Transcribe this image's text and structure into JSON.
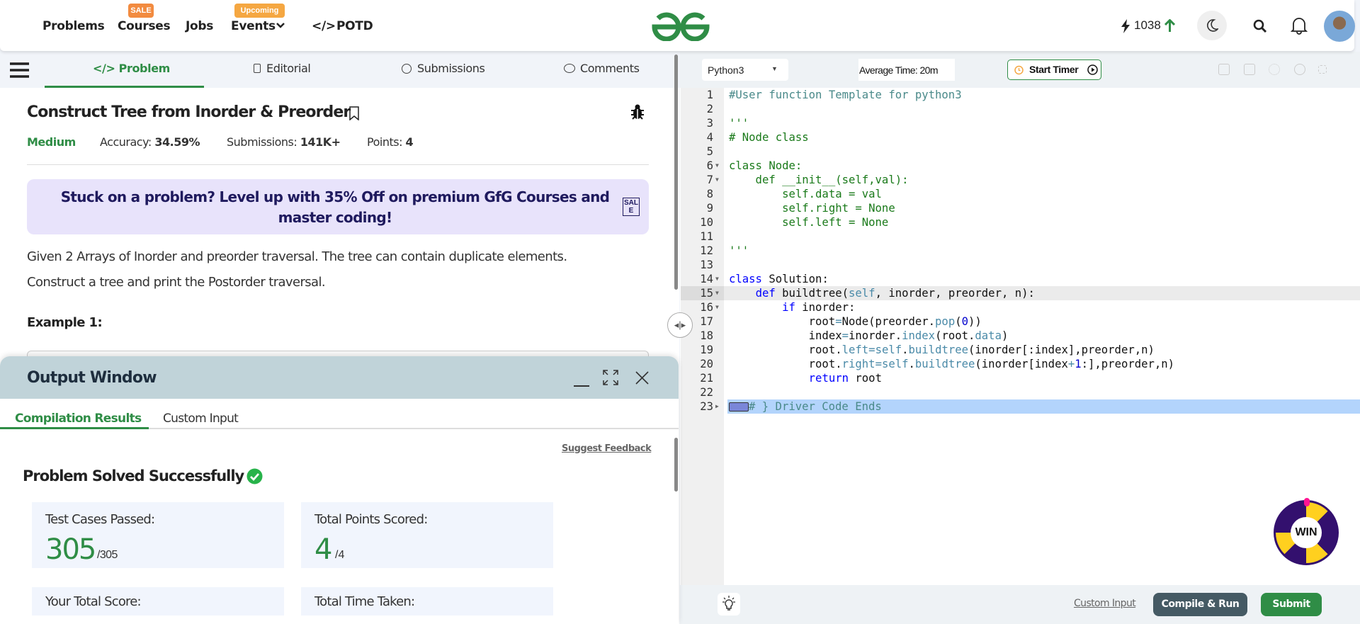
{
  "header": {
    "nav": [
      {
        "label": "Problems"
      },
      {
        "label": "Courses",
        "badge": "SALE"
      },
      {
        "label": "Jobs"
      },
      {
        "label": "Events",
        "badge": "Upcoming"
      },
      {
        "label": "POTD"
      }
    ],
    "potd_icon": "</>",
    "streak": "1038",
    "icons": [
      "bolt-icon",
      "arrow-up-icon",
      "moon-icon",
      "search-icon",
      "bell-icon",
      "avatar"
    ],
    "colors": {
      "brand": "#2f8d46",
      "sale_badge": "#f28b40",
      "upcoming_badge": "#f5a742"
    }
  },
  "left": {
    "tabs": [
      {
        "label": "Problem",
        "icon": "</>",
        "active": true
      },
      {
        "label": "Editorial"
      },
      {
        "label": "Submissions"
      },
      {
        "label": "Comments"
      }
    ],
    "problem": {
      "title": "Construct Tree from Inorder & Preorder",
      "difficulty": "Medium",
      "accuracy_label": "Accuracy:",
      "accuracy": "34.59%",
      "submissions_label": "Submissions:",
      "submissions": "141K+",
      "points_label": "Points:",
      "points": "4",
      "banner": "Stuck on a problem? Level up with 35% Off on premium GfG Courses and master coding!",
      "banner_badge": "SALE",
      "description": [
        "Given 2 Arrays of Inorder and preorder traversal. The tree can contain duplicate elements.",
        "Construct a tree and print the Postorder traversal."
      ],
      "example_heading": "Example 1:"
    }
  },
  "output": {
    "title": "Output Window",
    "tabs": [
      {
        "label": "Compilation Results",
        "active": true
      },
      {
        "label": "Custom Input"
      }
    ],
    "suggest_feedback": "Suggest Feedback",
    "status": "Problem Solved Successfully",
    "cards": [
      {
        "label": "Test Cases Passed:",
        "value": "305",
        "total": "/305"
      },
      {
        "label": "Total Points Scored:",
        "value": "4",
        "total": "/4"
      },
      {
        "label": "Your Total Score:"
      },
      {
        "label": "Total Time Taken:"
      }
    ]
  },
  "editor": {
    "language": "Python3",
    "average_time": "Average Time: 20m",
    "start_timer": "Start Timer",
    "code": [
      [
        [
          "#User function Template for python3",
          "cm"
        ]
      ],
      [],
      [
        [
          "'''",
          "st"
        ]
      ],
      [
        [
          "# Node class",
          "st"
        ]
      ],
      [],
      [
        [
          "class Node:",
          "st"
        ]
      ],
      [
        [
          "    def __init__(self,val):",
          "st"
        ]
      ],
      [
        [
          "        self.data = val",
          "st"
        ]
      ],
      [
        [
          "        self.right = None",
          "st"
        ]
      ],
      [
        [
          "        self.left = None",
          "st"
        ]
      ],
      [],
      [
        [
          "'''",
          "st"
        ]
      ],
      [],
      [
        [
          "class",
          "kw"
        ],
        [
          " Solution:",
          "tx"
        ]
      ],
      [
        [
          "    ",
          "tx"
        ],
        [
          "def",
          "kw"
        ],
        [
          " buildtree(",
          "tx"
        ],
        [
          "self",
          "sf"
        ],
        [
          ", inorder, preorder, n):",
          "tx"
        ]
      ],
      [
        [
          "        ",
          "tx"
        ],
        [
          "if",
          "kw"
        ],
        [
          " inorder:",
          "tx"
        ]
      ],
      [
        [
          "            root",
          "tx"
        ],
        [
          "=",
          "sf"
        ],
        [
          "Node(preorder.",
          "tx"
        ],
        [
          "pop",
          "sf"
        ],
        [
          "(",
          "tx"
        ],
        [
          "0",
          "nm"
        ],
        [
          "))",
          "tx"
        ]
      ],
      [
        [
          "            index",
          "tx"
        ],
        [
          "=",
          "sf"
        ],
        [
          "inorder.",
          "tx"
        ],
        [
          "index",
          "sf"
        ],
        [
          "(root.",
          "tx"
        ],
        [
          "data",
          "sf"
        ],
        [
          ")",
          "tx"
        ]
      ],
      [
        [
          "            root.",
          "tx"
        ],
        [
          "left",
          "sf"
        ],
        [
          "=",
          "sf"
        ],
        [
          "self",
          "sf"
        ],
        [
          ".",
          "tx"
        ],
        [
          "buildtree",
          "sf"
        ],
        [
          "(inorder[:index],preorder,n)",
          "tx"
        ]
      ],
      [
        [
          "            root.",
          "tx"
        ],
        [
          "right",
          "sf"
        ],
        [
          "=",
          "sf"
        ],
        [
          "self",
          "sf"
        ],
        [
          ".",
          "tx"
        ],
        [
          "buildtree",
          "sf"
        ],
        [
          "(inorder[index",
          "tx"
        ],
        [
          "+",
          "sf"
        ],
        [
          "1",
          "nm"
        ],
        [
          ":],preorder,n)",
          "tx"
        ]
      ],
      [
        [
          "            ",
          "tx"
        ],
        [
          "return",
          "kw"
        ],
        [
          " root",
          "tx"
        ]
      ],
      [],
      [
        [
          "# } Driver Code Ends",
          "cm"
        ]
      ]
    ],
    "fold_lines": [
      6,
      7,
      14,
      15,
      16
    ],
    "active_line": 15,
    "selected_line": 23,
    "custom_input": "Custom Input",
    "compile_run": "Compile & Run",
    "submit": "Submit",
    "win_badge": "WIN"
  }
}
